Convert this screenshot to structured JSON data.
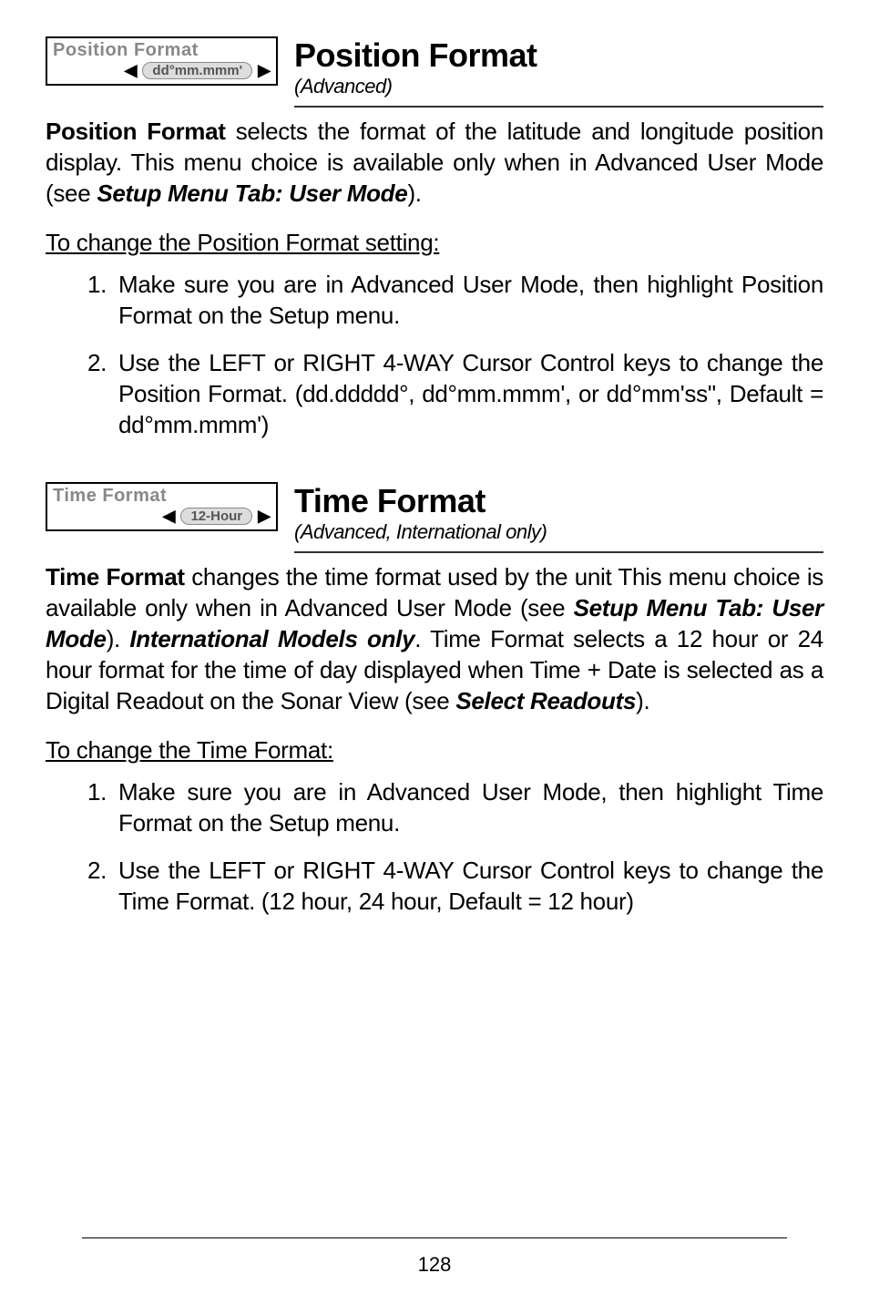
{
  "section1": {
    "ui_title": "Position Format",
    "ui_value": "dd°mm.mmm'",
    "heading": "Position Format",
    "subheading": "(Advanced)",
    "intro_bold": "Position Format",
    "intro_text": " selects the format of the latitude and longitude position display. This menu choice is available only when in Advanced User Mode (see ",
    "intro_italic": "Setup Menu Tab: User Mode",
    "intro_end": ").",
    "howto_title": "To change the Position Format setting:",
    "step1": "Make sure you are in Advanced User Mode, then highlight Position Format on the Setup menu.",
    "step2": "Use the LEFT or RIGHT 4-WAY Cursor Control keys to change the Position Format. (dd.ddddd°, dd°mm.mmm', or dd°mm'ss\", Default = dd°mm.mmm')"
  },
  "section2": {
    "ui_title": "Time Format",
    "ui_value": "12-Hour",
    "heading": "Time Format",
    "subheading": "(Advanced, International only)",
    "intro_bold": "Time Format",
    "intro_text1": " changes the time format used by the unit This menu choice is available only when in Advanced User Mode (see ",
    "intro_italic1": "Setup Menu Tab: User Mode",
    "intro_text2": "). ",
    "intro_italic2": "International Models only",
    "intro_text3": ". Time Format selects a 12 hour or 24 hour format for the time of day displayed when Time + Date is selected as a Digital Readout on the Sonar View (see ",
    "intro_italic3": "Select Readouts",
    "intro_end": ").",
    "howto_title": "To change the Time Format:",
    "step1": "Make sure you are in Advanced User Mode, then highlight Time Format on the Setup menu.",
    "step2": "Use the LEFT or RIGHT 4-WAY Cursor Control keys to change the Time Format. (12 hour, 24 hour, Default = 12 hour)"
  },
  "page_number": "128"
}
